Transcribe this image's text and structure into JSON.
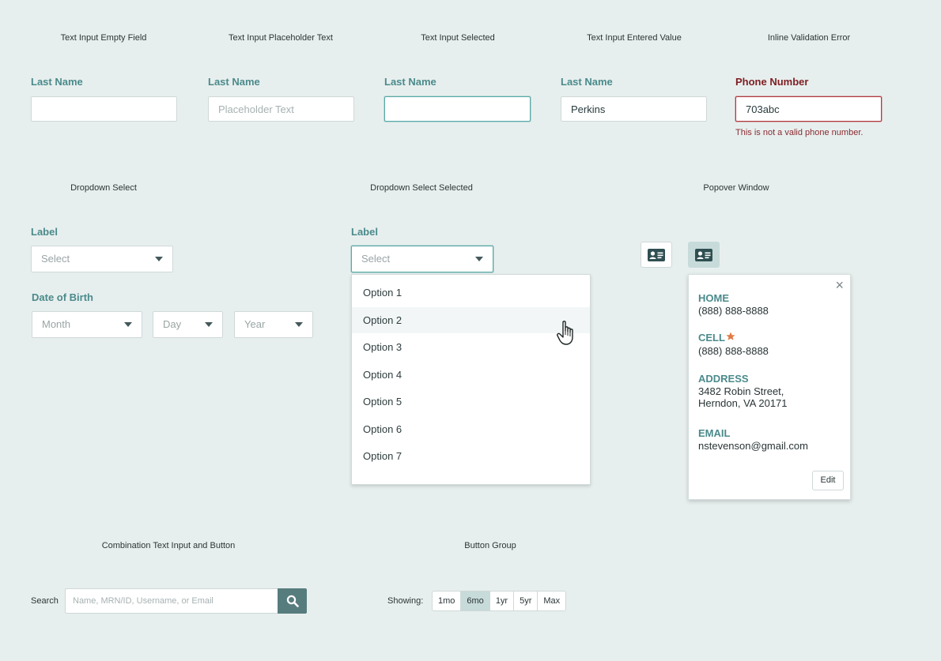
{
  "section1": {
    "captions": [
      "Text Input Empty Field",
      "Text Input Placeholder Text",
      "Text Input Selected",
      "Text Input Entered Value",
      "Inline Validation Error"
    ],
    "empty": {
      "label": "Last Name",
      "value": ""
    },
    "placeholder": {
      "label": "Last Name",
      "placeholder": "Placeholder Text"
    },
    "selected": {
      "label": "Last Name",
      "value": ""
    },
    "entered": {
      "label": "Last Name",
      "value": "Perkins"
    },
    "error": {
      "label": "Phone Number",
      "value": "703abc",
      "message": "This is not a valid phone number."
    }
  },
  "section2": {
    "captions": {
      "dropdown": "Dropdown Select",
      "dropdown_selected": "Dropdown Select Selected",
      "popover": "Popover Window"
    },
    "dropdown": {
      "label": "Label",
      "value": "Select"
    },
    "dob": {
      "label": "Date of Birth",
      "month": "Month",
      "day": "Day",
      "year": "Year"
    },
    "dropdown_selected": {
      "label": "Label",
      "value": "Select",
      "options": [
        "Option 1",
        "Option 2",
        "Option 3",
        "Option 4",
        "Option 5",
        "Option 6",
        "Option 7"
      ],
      "hovered_option": "Option 2"
    },
    "popover": {
      "close": "×",
      "home_label": "HOME",
      "home_value": "(888) 888-8888",
      "cell_label": "CELL",
      "cell_value": "(888) 888-8888",
      "address_label": "ADDRESS",
      "address_line1": "3482 Robin Street,",
      "address_line2": "Herndon, VA 20171",
      "email_label": "EMAIL",
      "email_value": "nstevenson@gmail.com",
      "edit_label": "Edit",
      "star_color": "#e07a45"
    }
  },
  "section3": {
    "captions": {
      "combo": "Combination Text Input and Button",
      "button_group": "Button Group"
    },
    "search": {
      "label": "Search",
      "placeholder": "Name, MRN/ID, Username, or Email"
    },
    "button_group": {
      "label": "Showing:",
      "buttons": [
        "1mo",
        "6mo",
        "1yr",
        "5yr",
        "Max"
      ],
      "active": "6mo"
    }
  },
  "colors": {
    "background": "#e7efee",
    "label_teal": "#4b8a8b",
    "focus_teal": "#5aa9a6",
    "error_red": "#b23a42",
    "search_button": "#577c7e",
    "active_button": "#c7dbda"
  }
}
